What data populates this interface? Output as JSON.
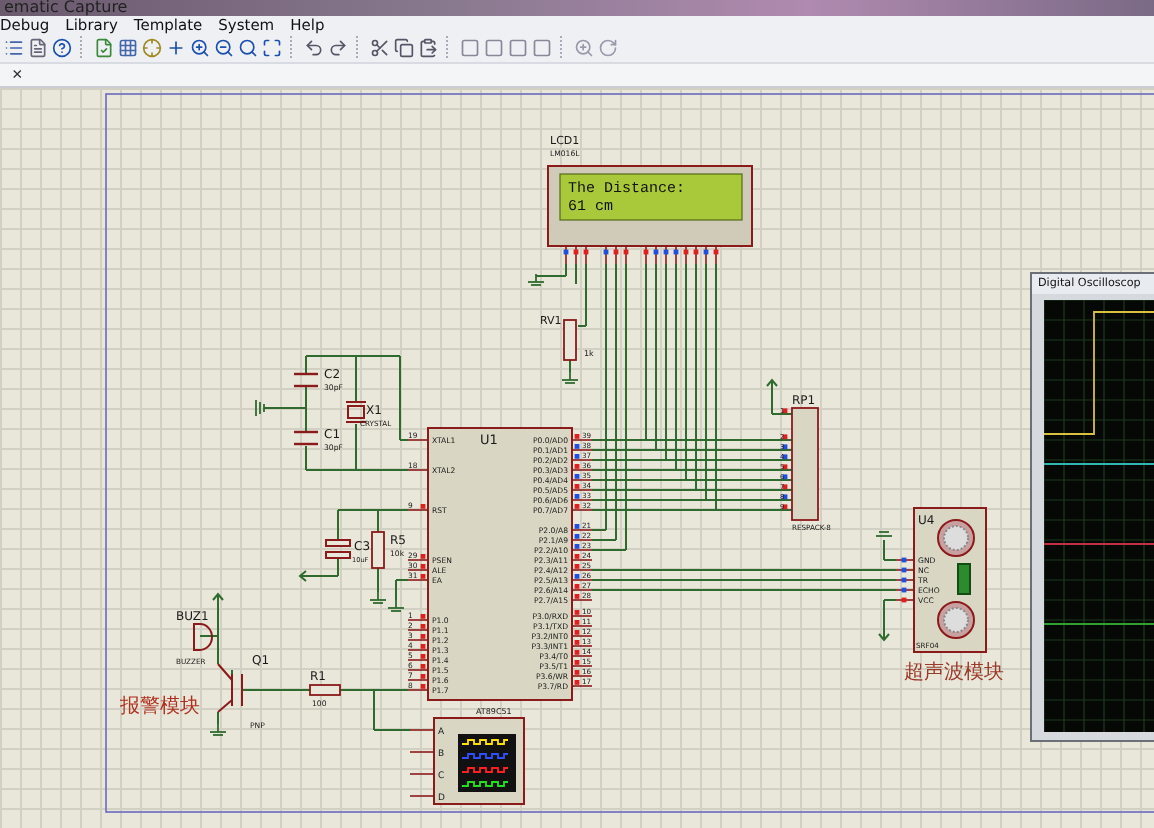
{
  "window": {
    "title": "ematic Capture"
  },
  "menu": [
    "Debug",
    "Library",
    "Template",
    "System",
    "Help"
  ],
  "tab": {
    "close": "×"
  },
  "lcd": {
    "ref": "LCD1",
    "part": "LM016L",
    "lines": [
      "The Distance:",
      "61 cm"
    ],
    "pins": [
      {
        "high": false
      },
      {
        "high": true
      },
      {
        "high": true
      },
      {
        "high": false
      },
      {
        "high": true
      },
      {
        "high": true
      },
      {
        "high": true
      },
      {
        "high": false
      },
      {
        "high": false
      },
      {
        "high": false
      },
      {
        "high": true
      },
      {
        "high": true
      },
      {
        "high": false
      },
      {
        "high": true
      }
    ]
  },
  "rv1": {
    "ref": "RV1",
    "value": "1k"
  },
  "c2": {
    "ref": "C2",
    "value": "30pF"
  },
  "c1": {
    "ref": "C1",
    "value": "30pF"
  },
  "x1": {
    "ref": "X1",
    "value": "CRYSTAL"
  },
  "c3": {
    "ref": "C3",
    "value": "10uF"
  },
  "r5": {
    "ref": "R5",
    "value": "10k"
  },
  "u1": {
    "ref": "U1",
    "part": "AT89C51",
    "left": [
      {
        "num": "19",
        "name": "XTAL1"
      },
      {
        "num": "18",
        "name": "XTAL2"
      },
      {
        "num": "9",
        "name": "RST",
        "high": true
      },
      {
        "num": "29",
        "name": "PSEN",
        "high": true
      },
      {
        "num": "30",
        "name": "ALE",
        "high": true
      },
      {
        "num": "31",
        "name": "EA",
        "high": true
      },
      {
        "num": "1",
        "name": "P1.0",
        "high": true
      },
      {
        "num": "2",
        "name": "P1.1",
        "high": true
      },
      {
        "num": "3",
        "name": "P1.2",
        "high": true
      },
      {
        "num": "4",
        "name": "P1.3",
        "high": true
      },
      {
        "num": "5",
        "name": "P1.4",
        "high": true
      },
      {
        "num": "6",
        "name": "P1.5",
        "high": true
      },
      {
        "num": "7",
        "name": "P1.6",
        "high": true
      },
      {
        "num": "8",
        "name": "P1.7",
        "high": true
      }
    ],
    "right": [
      {
        "num": "39",
        "name": "P0.0/AD0",
        "high": true
      },
      {
        "num": "38",
        "name": "P0.1/AD1",
        "high": false
      },
      {
        "num": "37",
        "name": "P0.2/AD2",
        "high": false
      },
      {
        "num": "36",
        "name": "P0.3/AD3",
        "high": true
      },
      {
        "num": "35",
        "name": "P0.4/AD4",
        "high": false
      },
      {
        "num": "34",
        "name": "P0.5/AD5",
        "high": true
      },
      {
        "num": "33",
        "name": "P0.6/AD6",
        "high": false
      },
      {
        "num": "32",
        "name": "P0.7/AD7",
        "high": true
      },
      {
        "num": "21",
        "name": "P2.0/A8",
        "high": false
      },
      {
        "num": "22",
        "name": "P2.1/A9",
        "high": false
      },
      {
        "num": "23",
        "name": "P2.2/A10",
        "high": false
      },
      {
        "num": "24",
        "name": "P2.3/A11",
        "high": true
      },
      {
        "num": "25",
        "name": "P2.4/A12",
        "high": true
      },
      {
        "num": "26",
        "name": "P2.5/A13",
        "high": false
      },
      {
        "num": "27",
        "name": "P2.6/A14",
        "high": true
      },
      {
        "num": "28",
        "name": "P2.7/A15",
        "high": true
      },
      {
        "num": "10",
        "name": "P3.0/RXD",
        "high": true
      },
      {
        "num": "11",
        "name": "P3.1/TXD",
        "high": true
      },
      {
        "num": "12",
        "name": "P3.2/INT0",
        "high": true
      },
      {
        "num": "13",
        "name": "P3.3/INT1",
        "high": true
      },
      {
        "num": "14",
        "name": "P3.4/T0",
        "high": true
      },
      {
        "num": "15",
        "name": "P3.5/T1",
        "high": true
      },
      {
        "num": "16",
        "name": "P3.6/WR",
        "high": true
      },
      {
        "num": "17",
        "name": "P3.7/RD",
        "high": true
      }
    ]
  },
  "rp1": {
    "ref": "RP1",
    "part": "RESPACK-8",
    "pins": [
      {
        "num": "1",
        "high": true
      },
      {
        "num": "2",
        "high": true
      },
      {
        "num": "3",
        "high": false
      },
      {
        "num": "4",
        "high": false
      },
      {
        "num": "5",
        "high": true
      },
      {
        "num": "6",
        "high": false
      },
      {
        "num": "7",
        "high": true
      },
      {
        "num": "8",
        "high": false
      },
      {
        "num": "9",
        "high": true
      }
    ]
  },
  "u4": {
    "ref": "U4",
    "part": "SRF04",
    "caption": "超声波模块",
    "pins": [
      {
        "name": "GND",
        "high": false
      },
      {
        "name": "NC",
        "high": false
      },
      {
        "name": "TR",
        "high": false
      },
      {
        "name": "ECHO",
        "high": false
      },
      {
        "name": "VCC",
        "high": true
      }
    ]
  },
  "buz1": {
    "ref": "BUZ1",
    "part": "BUZZER"
  },
  "q1": {
    "ref": "Q1",
    "part": "PNP"
  },
  "r1": {
    "ref": "R1",
    "value": "100"
  },
  "alarm_caption": "报警模块",
  "scope_instrument": {
    "channels": [
      "A",
      "B",
      "C",
      "D"
    ]
  },
  "oscilloscope_window": {
    "title": "Digital Oscilloscop"
  }
}
